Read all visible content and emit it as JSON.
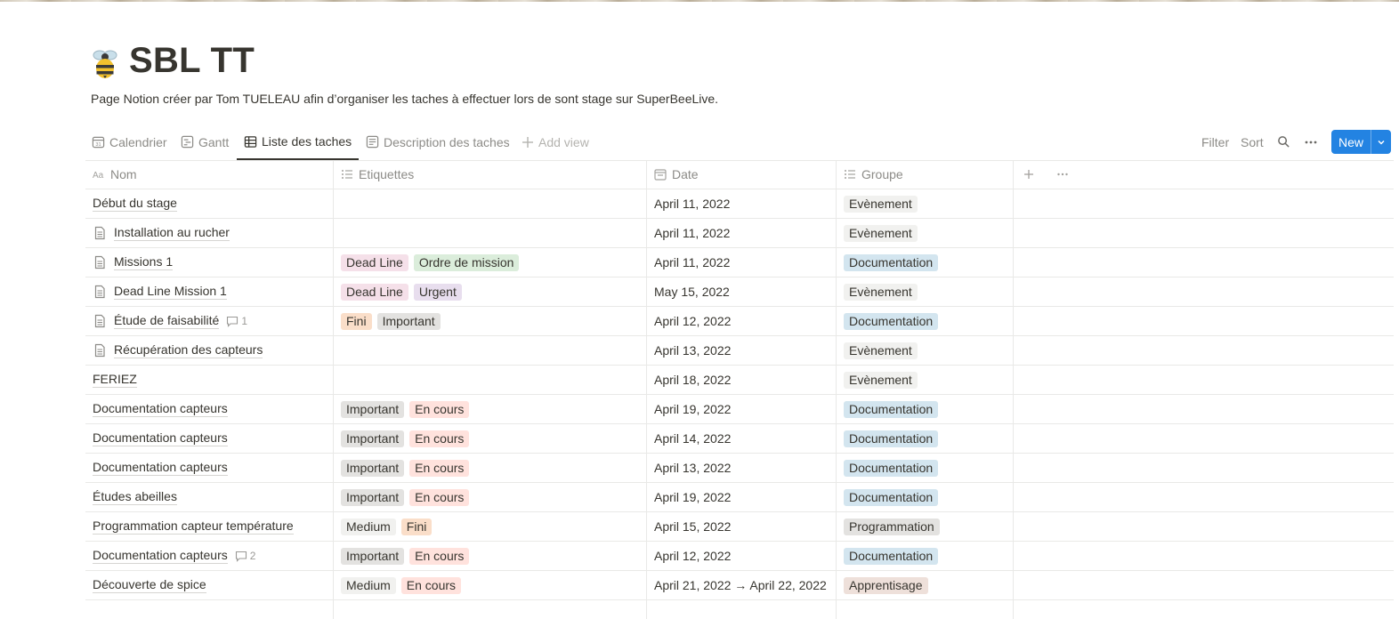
{
  "page": {
    "title": "SBL TT",
    "icon": "bee-icon",
    "description": "Page Notion créer par Tom TUELEAU afin d’organiser les taches à effectuer lors de sont stage sur SuperBeeLive."
  },
  "views": [
    {
      "label": "Calendrier",
      "icon": "calendar-icon"
    },
    {
      "label": "Gantt",
      "icon": "timeline-icon"
    },
    {
      "label": "Liste des taches",
      "icon": "table-icon",
      "active": true
    },
    {
      "label": "Description des taches",
      "icon": "page-icon"
    }
  ],
  "add_view_label": "Add view",
  "toolbar": {
    "filter": "Filter",
    "sort": "Sort",
    "new": "New"
  },
  "columns": {
    "name": "Nom",
    "tags": "Etiquettes",
    "date": "Date",
    "group": "Groupe"
  },
  "colors": {
    "accent": "#2383e2",
    "tag_red": "#ffe2dd",
    "tag_pink": "#f5e0e9",
    "tag_green": "#dbeddb",
    "tag_purple": "#e8deee",
    "tag_orange": "#fadec9",
    "tag_gray": "#e3e2e0",
    "tag_lightgray": "#f1f1ef",
    "tag_blue": "#d3e5ef",
    "tag_brown": "#eee0da"
  },
  "rows": [
    {
      "name": "Début du stage",
      "page": false,
      "tags": [],
      "date": "April 11, 2022",
      "group": {
        "label": "Evènement",
        "color": "#f1f1ef"
      }
    },
    {
      "name": "Installation au rucher",
      "page": true,
      "tags": [],
      "date": "April 11, 2022",
      "group": {
        "label": "Evènement",
        "color": "#f1f1ef"
      }
    },
    {
      "name": "Missions 1",
      "page": true,
      "tags": [
        {
          "label": "Dead Line",
          "color": "#f5e0e9"
        },
        {
          "label": "Ordre de mission",
          "color": "#dbeddb"
        }
      ],
      "date": "April 11, 2022",
      "group": {
        "label": "Documentation",
        "color": "#d3e5ef"
      }
    },
    {
      "name": "Dead Line Mission 1",
      "page": true,
      "tags": [
        {
          "label": "Dead Line",
          "color": "#f5e0e9"
        },
        {
          "label": "Urgent",
          "color": "#e8deee"
        }
      ],
      "date": "May 15, 2022",
      "group": {
        "label": "Evènement",
        "color": "#f1f1ef"
      }
    },
    {
      "name": "Étude de faisabilité",
      "page": true,
      "comments": "1",
      "tags": [
        {
          "label": "Fini",
          "color": "#fadec9"
        },
        {
          "label": "Important",
          "color": "#e3e2e0"
        }
      ],
      "date": "April 12, 2022",
      "group": {
        "label": "Documentation",
        "color": "#d3e5ef"
      }
    },
    {
      "name": "Récupération des capteurs",
      "page": true,
      "tags": [],
      "date": "April 13, 2022",
      "group": {
        "label": "Evènement",
        "color": "#f1f1ef"
      }
    },
    {
      "name": "FERIEZ",
      "page": false,
      "tags": [],
      "date": "April 18, 2022",
      "group": {
        "label": "Evènement",
        "color": "#f1f1ef"
      }
    },
    {
      "name": "Documentation capteurs",
      "page": false,
      "tags": [
        {
          "label": "Important",
          "color": "#e3e2e0"
        },
        {
          "label": "En cours",
          "color": "#ffe2dd"
        }
      ],
      "date": "April 19, 2022",
      "group": {
        "label": "Documentation",
        "color": "#d3e5ef"
      }
    },
    {
      "name": "Documentation capteurs",
      "page": false,
      "tags": [
        {
          "label": "Important",
          "color": "#e3e2e0"
        },
        {
          "label": "En cours",
          "color": "#ffe2dd"
        }
      ],
      "date": "April 14, 2022",
      "group": {
        "label": "Documentation",
        "color": "#d3e5ef"
      }
    },
    {
      "name": "Documentation capteurs",
      "page": false,
      "tags": [
        {
          "label": "Important",
          "color": "#e3e2e0"
        },
        {
          "label": "En cours",
          "color": "#ffe2dd"
        }
      ],
      "date": "April 13, 2022",
      "group": {
        "label": "Documentation",
        "color": "#d3e5ef"
      }
    },
    {
      "name": "Études abeilles",
      "page": false,
      "tags": [
        {
          "label": "Important",
          "color": "#e3e2e0"
        },
        {
          "label": "En cours",
          "color": "#ffe2dd"
        }
      ],
      "date": "April 19, 2022",
      "group": {
        "label": "Documentation",
        "color": "#d3e5ef"
      }
    },
    {
      "name": "Programmation capteur température",
      "page": false,
      "tags": [
        {
          "label": "Medium",
          "color": "#f1f1ef"
        },
        {
          "label": "Fini",
          "color": "#fadec9"
        }
      ],
      "date": "April 15, 2022",
      "group": {
        "label": "Programmation",
        "color": "#e3e2e0"
      }
    },
    {
      "name": "Documentation capteurs",
      "page": false,
      "comments": "2",
      "tags": [
        {
          "label": "Important",
          "color": "#e3e2e0"
        },
        {
          "label": "En cours",
          "color": "#ffe2dd"
        }
      ],
      "date": "April 12, 2022",
      "group": {
        "label": "Documentation",
        "color": "#d3e5ef"
      }
    },
    {
      "name": "Découverte de spice",
      "page": false,
      "tags": [
        {
          "label": "Medium",
          "color": "#f1f1ef"
        },
        {
          "label": "En cours",
          "color": "#ffe2dd"
        }
      ],
      "date": "April 21, 2022 → April 22, 2022",
      "group": {
        "label": "Apprentisage",
        "color": "#eee0da"
      }
    }
  ]
}
